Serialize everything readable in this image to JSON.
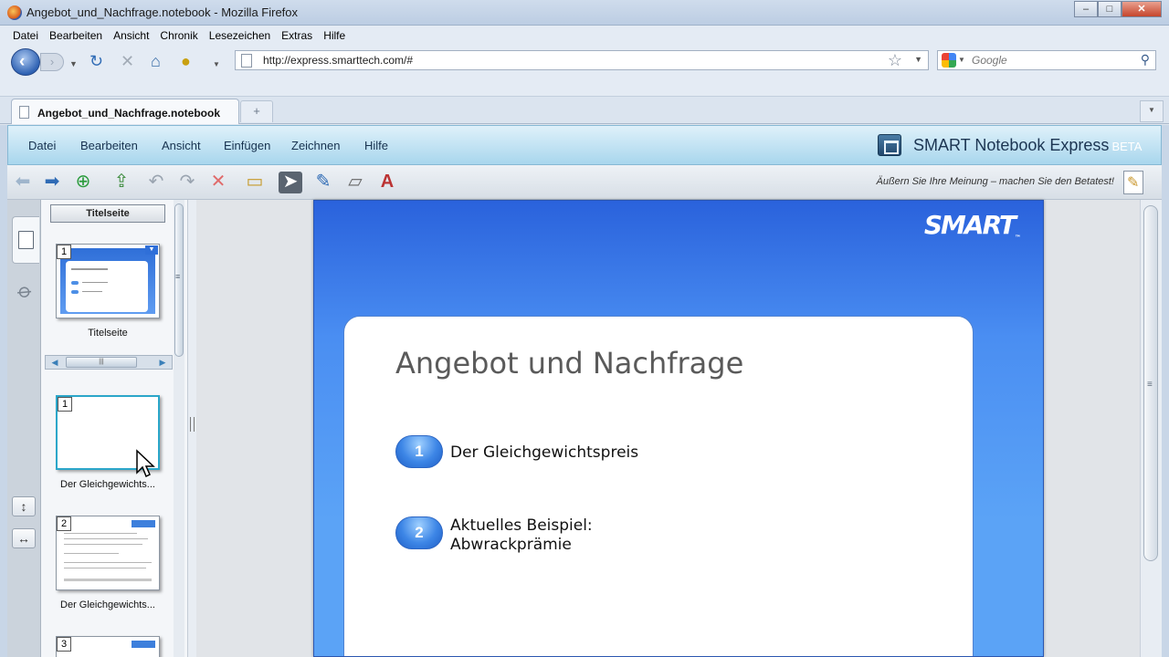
{
  "window": {
    "title": "Angebot_und_Nachfrage.notebook - Mozilla Firefox"
  },
  "browser_menu": [
    {
      "label": "Datei"
    },
    {
      "label": "Bearbeiten"
    },
    {
      "label": "Ansicht"
    },
    {
      "label": "Chronik"
    },
    {
      "label": "Lesezeichen"
    },
    {
      "label": "Extras"
    },
    {
      "label": "Hilfe"
    }
  ],
  "nav": {
    "url": "http://express.smarttech.com/#",
    "search_placeholder": "Google"
  },
  "tabs": [
    {
      "label": "Angebot_und_Nachfrage.notebook"
    }
  ],
  "app_menu": [
    {
      "label": "Datei"
    },
    {
      "label": "Bearbeiten"
    },
    {
      "label": "Ansicht"
    },
    {
      "label": "Einfügen"
    },
    {
      "label": "Zeichnen"
    },
    {
      "label": "Hilfe"
    }
  ],
  "brand": {
    "name": "SMART Notebook Express",
    "beta": "BETA"
  },
  "toolbar": {
    "feedback": "Äußern Sie Ihre Meinung – machen Sie den Betatest!"
  },
  "sorter": {
    "group_title": "Titelseite",
    "pages": [
      {
        "number": "1",
        "label": "Titelseite"
      },
      {
        "number": "1",
        "label": "Der Gleichgewichts..."
      },
      {
        "number": "2",
        "label": "Der Gleichgewichts..."
      },
      {
        "number": "3",
        "label": ""
      }
    ]
  },
  "slide": {
    "logo": "SMART",
    "title": "Angebot und Nachfrage",
    "items": [
      {
        "number": "1",
        "text": "Der Gleichgewichtspreis"
      },
      {
        "number": "2",
        "text_line1": "Aktuelles Beispiel:",
        "text_line2": "Abwrackprämie"
      }
    ]
  },
  "colors": {
    "slide_blue": "#4a8ef2",
    "app_menu_bg": "#a8d6ed",
    "selection_border": "#2ba6c9"
  }
}
